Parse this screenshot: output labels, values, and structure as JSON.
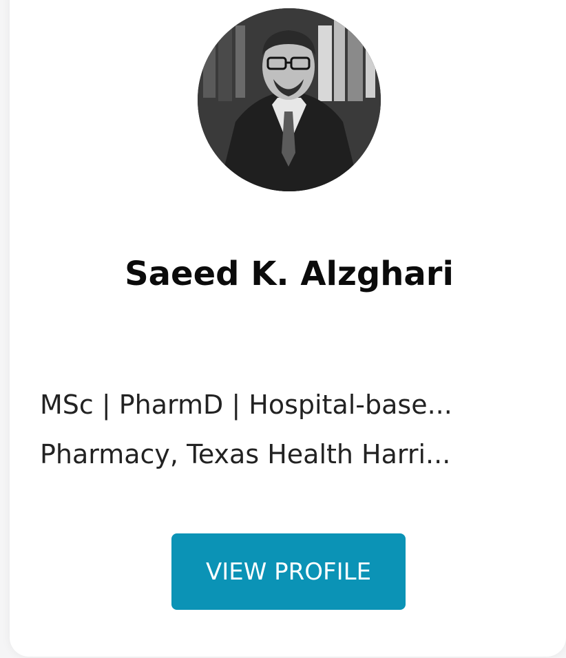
{
  "profile": {
    "name": "Saeed K. Alzghari",
    "bio_line_1": "MSc | PharmD | Hospital-base...",
    "bio_line_2": "Pharmacy, Texas Health Harri...",
    "button_label": "VIEW PROFILE",
    "avatar": "portrait-photo"
  },
  "colors": {
    "button_bg": "#0b93b6",
    "button_text": "#ffffff",
    "name_text": "#0b0b0b"
  }
}
